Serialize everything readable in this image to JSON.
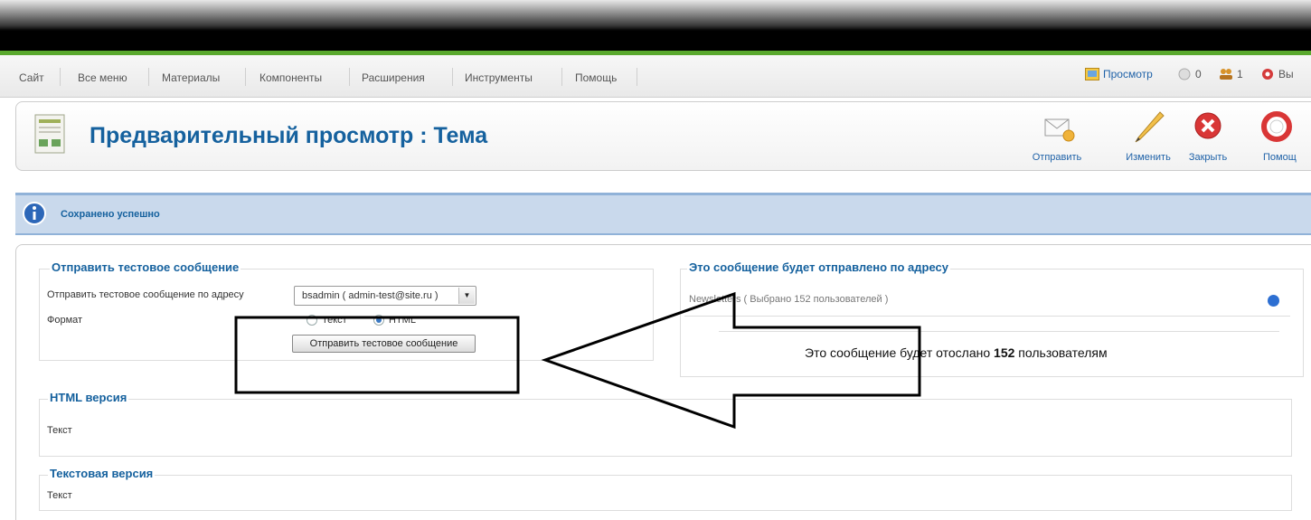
{
  "menu": {
    "items": [
      "Сайт",
      "Все меню",
      "Материалы",
      "Компоненты",
      "Расширения",
      "Инструменты",
      "Помощь"
    ],
    "status": {
      "preview": "Просмотр",
      "messages": "0",
      "users": "1",
      "logout": "Вы"
    }
  },
  "toolbar": {
    "title": "Предварительный просмотр : Тема",
    "buttons": {
      "send": "Отправить",
      "edit": "Изменить",
      "close": "Закрыть",
      "help": "Помощ"
    }
  },
  "message": {
    "text": "Сохранено успешно"
  },
  "test_message": {
    "legend": "Отправить тестовое сообщение",
    "address_label": "Отправить тестовое сообщение по адресу",
    "address_value": "bsadmin ( admin-test@site.ru )",
    "format_label": "Формат",
    "format_options": [
      "Текст",
      "HTML"
    ],
    "selected_format": "HTML",
    "send_button": "Отправить тестовое сообщение"
  },
  "recipients": {
    "legend": "Это сообщение будет отправлено по адресу",
    "list_name": "Newsletters ( Выбрано 152 пользователей )",
    "summary_prefix": "Это сообщение будет отослано",
    "summary_count": "152",
    "summary_suffix": "пользователям"
  },
  "html_version": {
    "legend": "HTML версия",
    "body": "Текст"
  },
  "text_version": {
    "legend": "Текстовая версия",
    "body": "Текст"
  },
  "colors": {
    "accent": "#15619e",
    "green_line": "#5aa92e",
    "message_bg": "#c9d9ec",
    "radio_dot": "#2d6fd2"
  }
}
